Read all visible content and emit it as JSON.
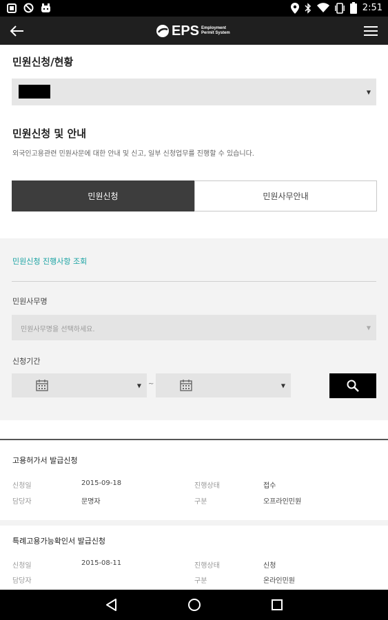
{
  "status_bar": {
    "time": "2:51",
    "left_icons": [
      "notification-icon",
      "blocked-icon",
      "app-notification-icon"
    ],
    "right_icons": [
      "location-icon",
      "bluetooth-icon",
      "wifi-icon",
      "vibrate-icon",
      "battery-icon"
    ]
  },
  "app_bar": {
    "logo_text": "EPS",
    "logo_sub_line1": "Employment",
    "logo_sub_line2": "Permit System"
  },
  "section1": {
    "title": "민원신청/현황",
    "select_caret": "▼"
  },
  "section2": {
    "title": "민원신청 및 안내",
    "description": "외국인고용관련 민원사문에 대한 안내 및 신고, 일부 신청업무를 진행할 수 있습니다."
  },
  "tabs": [
    {
      "label": "민원신청",
      "active": true
    },
    {
      "label": "민원사무안내",
      "active": false
    }
  ],
  "search": {
    "title": "민원신청 진행사항 조회",
    "office_label": "민원사무명",
    "office_placeholder": "민원사무명을 선택하세요.",
    "period_label": "신청기간",
    "caret": "▼",
    "tilde": "~"
  },
  "results": [
    {
      "title": "고용허가서 발급신청",
      "date_label": "신청일",
      "date": "2015-09-18",
      "status_label": "진행상태",
      "status": "접수",
      "manager_label": "담당자",
      "manager": "문명자",
      "type_label": "구분",
      "type": "오프라인민원"
    },
    {
      "title": "특례고용가능확인서 발급신청",
      "date_label": "신청일",
      "date": "2015-08-11",
      "status_label": "진행상태",
      "status": "신청",
      "manager_label": "담당자",
      "manager": "",
      "type_label": "구분",
      "type": "온라인민원"
    }
  ],
  "colors": {
    "app_bar": "#1f1f1f",
    "tab_active": "#3d3d3d",
    "accent_teal": "#1aa3a3",
    "panel_bg": "#f3f3f3"
  }
}
